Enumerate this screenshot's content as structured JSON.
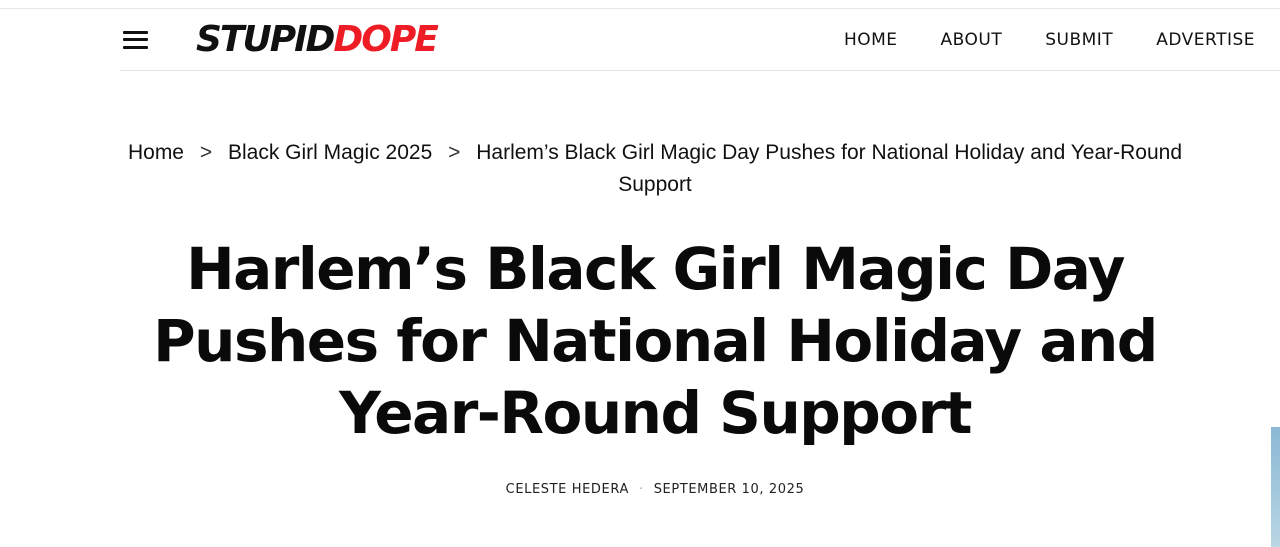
{
  "header": {
    "logo_part1": "STUPID",
    "logo_part2": "DOPE",
    "nav": [
      "HOME",
      "ABOUT",
      "SUBMIT",
      "ADVERTISE"
    ]
  },
  "breadcrumb": {
    "home": "Home",
    "category": "Black Girl Magic 2025",
    "current": "Harlem’s Black Girl Magic Day Pushes for National Holiday and Year-Round Support",
    "separator": ">"
  },
  "article": {
    "title": "Harlem’s Black Girl Magic Day Pushes for National Holiday and Year-Round Support",
    "author": "CELESTE HEDERA",
    "meta_separator": "·",
    "date": "SEPTEMBER 10, 2025"
  },
  "colors": {
    "brand_red": "#ee1c25",
    "text": "#111111"
  },
  "icons": {
    "menu": "hamburger-menu-icon",
    "breadcrumb_separator": "chevron-right-icon"
  }
}
